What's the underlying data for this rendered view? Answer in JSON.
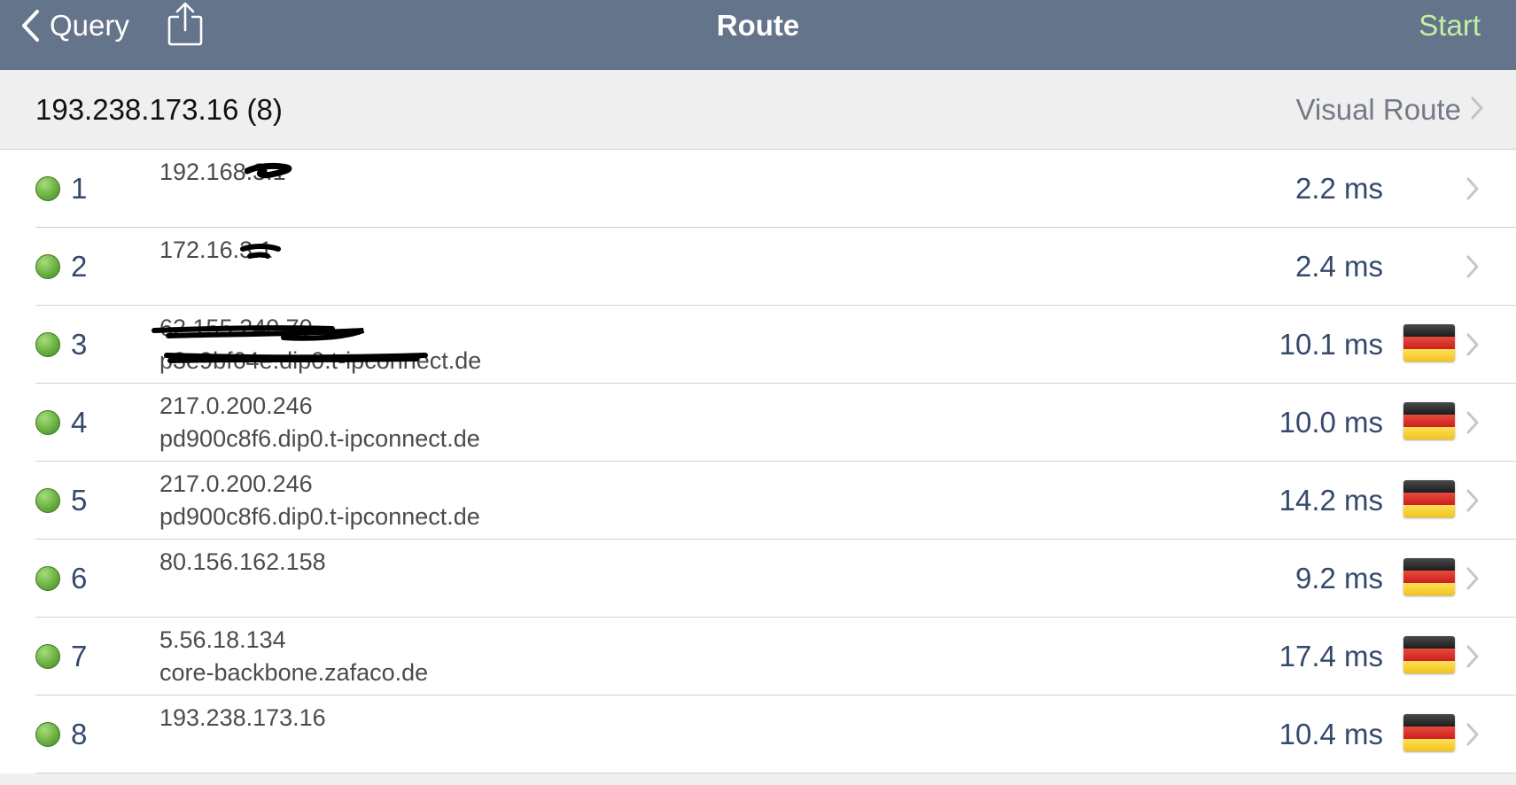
{
  "navbar": {
    "back_label": "Query",
    "title": "Route",
    "start_label": "Start",
    "back_icon": "chevron-left-icon",
    "share_icon": "share-icon"
  },
  "header": {
    "target": "193.238.173.16 (8)",
    "visual_route_label": "Visual Route"
  },
  "colors": {
    "navbar_bg": "#64748a",
    "start_accent": "#c2f0a4",
    "hop_text": "#34496c",
    "status_ok": "#6cb043"
  },
  "hops": [
    {
      "index": "1",
      "ip": "192.168.3.1",
      "host": "",
      "time": "2.2 ms",
      "country_flag": "",
      "status": "ok"
    },
    {
      "index": "2",
      "ip": "172.16.3.1",
      "host": "",
      "time": "2.4 ms",
      "country_flag": "",
      "status": "ok"
    },
    {
      "index": "3",
      "ip": "62.155.240.70",
      "host": "p3e9bf64e.dip0.t-ipconnect.de",
      "time": "10.1 ms",
      "country_flag": "germany-flag-icon",
      "status": "ok"
    },
    {
      "index": "4",
      "ip": "217.0.200.246",
      "host": "pd900c8f6.dip0.t-ipconnect.de",
      "time": "10.0 ms",
      "country_flag": "germany-flag-icon",
      "status": "ok"
    },
    {
      "index": "5",
      "ip": "217.0.200.246",
      "host": "pd900c8f6.dip0.t-ipconnect.de",
      "time": "14.2 ms",
      "country_flag": "germany-flag-icon",
      "status": "ok"
    },
    {
      "index": "6",
      "ip": "80.156.162.158",
      "host": "",
      "time": "9.2 ms",
      "country_flag": "germany-flag-icon",
      "status": "ok"
    },
    {
      "index": "7",
      "ip": "5.56.18.134",
      "host": "core-backbone.zafaco.de",
      "time": "17.4 ms",
      "country_flag": "germany-flag-icon",
      "status": "ok"
    },
    {
      "index": "8",
      "ip": "193.238.173.16",
      "host": "",
      "time": "10.4 ms",
      "country_flag": "germany-flag-icon",
      "status": "ok"
    }
  ]
}
